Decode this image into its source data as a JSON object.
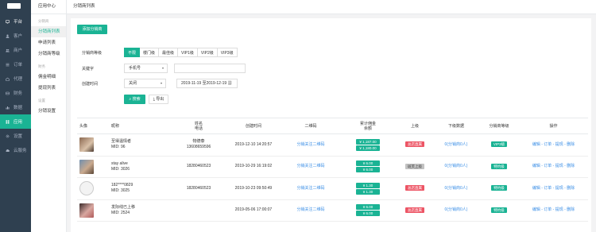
{
  "sidebar": {
    "items": [
      {
        "label": "平台",
        "icon": "desktop-icon"
      },
      {
        "label": "客户",
        "icon": "user-icon"
      },
      {
        "label": "商户",
        "icon": "users-icon"
      },
      {
        "label": "订单",
        "icon": "list-icon"
      },
      {
        "label": "代理",
        "icon": "agent-icon"
      },
      {
        "label": "财务",
        "icon": "finance-icon"
      },
      {
        "label": "数据",
        "icon": "chart-icon"
      },
      {
        "label": "应用",
        "icon": "apps-icon"
      },
      {
        "label": "设置",
        "icon": "gear-icon"
      },
      {
        "label": "云服务",
        "icon": "cloud-icon"
      }
    ]
  },
  "subnav": {
    "header": "应用中心",
    "group1": "分销商",
    "items1": [
      "分销商列表",
      "申请列表",
      "分销商等级"
    ],
    "group2": "财务",
    "items2": [
      "佣金明细",
      "提现列表"
    ],
    "group3": "设置",
    "items3": [
      "分销设置"
    ]
  },
  "breadcrumb": "分销商列表",
  "toolbar": {
    "add_label": "添加分销商"
  },
  "filters": {
    "level_label": "分销商等级",
    "levels": [
      "不限",
      "楼门级",
      "最佳级",
      "VIP1级",
      "VIP2级",
      "VIP3级"
    ],
    "keyword_label": "关键字",
    "keyword_field": "手机号",
    "created_label": "创建时间",
    "time_option": "关闭",
    "date_range": "2019-11-19 至2019-12-19",
    "search_label": "搜索",
    "export_label": "导出"
  },
  "table": {
    "headers": {
      "avatar": "头像",
      "nick": "昵称",
      "name1": "姓名",
      "name2": "电话",
      "created": "创建时间",
      "qrcode": "二维码",
      "commission1": "累计佣金",
      "commission2": "余额",
      "superior": "上级",
      "downline": "下级数据",
      "level": "分销商等级",
      "actions": "操作"
    },
    "rows": [
      {
        "nick": "至得温情者",
        "mid": "MID: 96",
        "name": "物德泰",
        "phone": "13608659596",
        "created": "2019-12-10 14:20:57",
        "qrcode": "分销关注二维码",
        "total": "¥ 1,187.00",
        "balance": "¥ 1,180.00",
        "superior": "总店直属",
        "downline": "0(分销商0人)",
        "level": "VIP3级",
        "actions": "编辑 - 订单 - 提现 - 删除"
      },
      {
        "nick": "stay alive",
        "mid": "MID: 3026",
        "name": "",
        "phone": "18280460523",
        "created": "2019-10-29 16:19:02",
        "qrcode": "分销关注二维码",
        "total": "¥ 6.00",
        "balance": "¥ 6.00",
        "superior": "斑芙上级",
        "downline": "0(分销商0人)",
        "level": "特约级",
        "actions": "编辑 - 订单 - 提现 - 删除"
      },
      {
        "nick": "182****0829",
        "mid": "MID: 3025",
        "name": "",
        "phone": "18280460523",
        "created": "2019-10-23 09:50:49",
        "qrcode": "分销关注二维码",
        "total": "¥ 1.30",
        "balance": "¥ 1.30",
        "superior": "总店直属",
        "downline": "0(分销商0人)",
        "level": "特约级",
        "actions": "编辑 - 订单 - 提现 - 删除"
      },
      {
        "nick": "发际线已上移",
        "mid": "MID: 2524",
        "name": "",
        "phone": "",
        "created": "2019-05-06 17:00:07",
        "qrcode": "分销关注二维码",
        "total": "¥ 6.00",
        "balance": "¥ 6.00",
        "superior": "总店直属",
        "downline": "0(分销商0人)",
        "level": "特约级",
        "actions": "编辑 - 订单 - 提现 - 删除"
      }
    ]
  },
  "colors": {
    "accent": "#1ab394",
    "sidebar": "#2f4050",
    "danger": "#ed5565",
    "link": "#3a8ee6"
  }
}
